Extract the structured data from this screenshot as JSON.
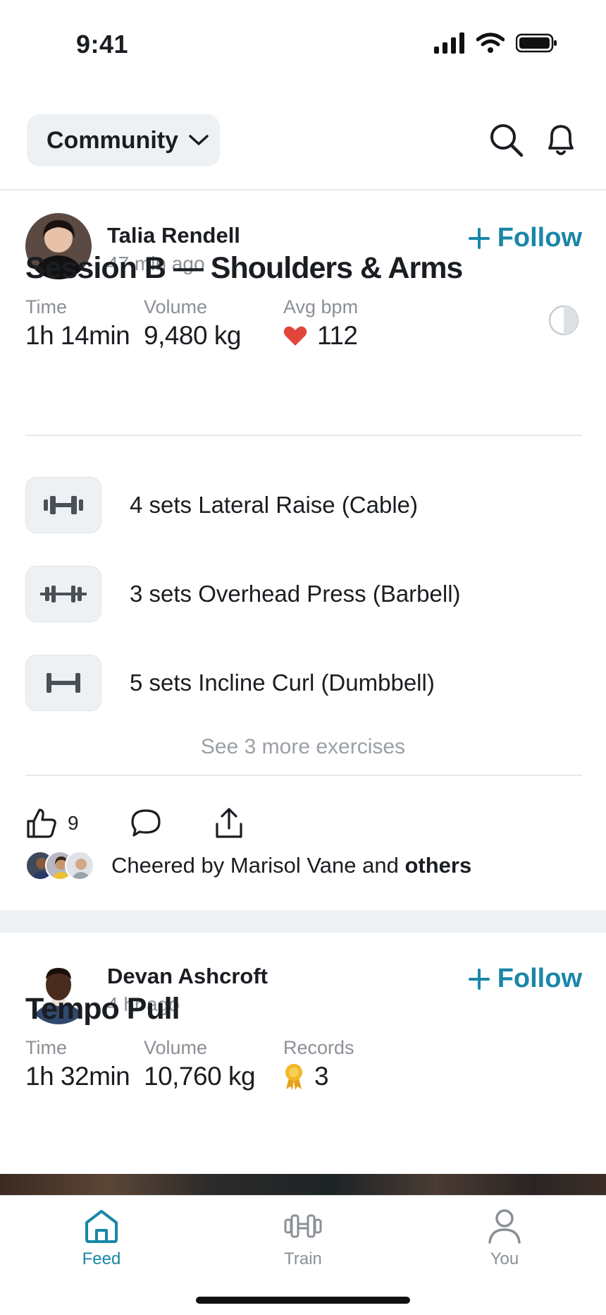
{
  "status_bar": {
    "time": "9:41"
  },
  "header": {
    "community_label": "Community",
    "icons": [
      "chevron-down-icon",
      "search-icon",
      "bell-icon"
    ]
  },
  "posts": [
    {
      "author": "Talia Rendell",
      "time_ago": "47 min ago",
      "follow_label": "Follow",
      "title": "Session B — Shoulders & Arms",
      "stats": [
        {
          "label": "Time",
          "value": "1h 14min"
        },
        {
          "label": "Volume",
          "value": "9,480 kg"
        },
        {
          "label": "Avg bpm",
          "value": "112",
          "icon": "heart-icon"
        }
      ],
      "exercises": [
        {
          "label": "4 sets Lateral Raise (Cable)",
          "icon": "dumbbell-icon"
        },
        {
          "label": "3 sets Overhead Press (Barbell)",
          "icon": "barbell-icon"
        },
        {
          "label": "5 sets Incline Curl (Dumbbell)",
          "icon": "bar-icon"
        }
      ],
      "see_more": "See 3 more exercises",
      "like_count": "9",
      "cheer_prefix": "Cheered by Marisol Vane and",
      "cheer_suffix": "others"
    },
    {
      "author": "Devan Ashcroft",
      "time_ago": "4 hr ago",
      "follow_label": "Follow",
      "title": "Tempo Pull",
      "stats": [
        {
          "label": "Time",
          "value": "1h 32min"
        },
        {
          "label": "Volume",
          "value": "10,760 kg"
        },
        {
          "label": "Records",
          "value": "3",
          "icon": "medal-icon"
        }
      ]
    }
  ],
  "tabs": [
    {
      "label": "Feed",
      "active": true
    },
    {
      "label": "Train",
      "active": false
    },
    {
      "label": "You",
      "active": false
    }
  ],
  "colors": {
    "accent": "#1a86a8",
    "heart": "#e0463a",
    "muted": "#8b9096",
    "medal": "#f2b824"
  }
}
